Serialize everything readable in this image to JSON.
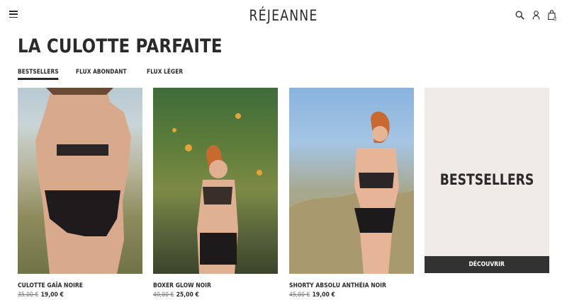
{
  "brand": "RÉJEANNE",
  "header": {
    "menu_icon": "hamburger-icon",
    "icons": [
      "search-icon",
      "account-icon",
      "cart-icon"
    ],
    "cart_count": "0"
  },
  "page_title": "LA CULOTTE PARFAITE",
  "tabs": [
    {
      "label": "BESTSELLERS",
      "active": true
    },
    {
      "label": "FLUX ABONDANT",
      "active": false
    },
    {
      "label": "FLUX LÉGER",
      "active": false
    }
  ],
  "products": [
    {
      "name": "CULOTTE GAÏA NOIRE",
      "old_price": "35,00 €",
      "price": "19,00 €"
    },
    {
      "name": "BOXER GLOW NOIR",
      "old_price": "40,00 €",
      "price": "25,00 €"
    },
    {
      "name": "SHORTY ABSOLU ANTHÉIA NOIR",
      "old_price": "45,00 €",
      "price": "19,00 €"
    }
  ],
  "promo": {
    "title": "BESTSELLERS",
    "button": "DÉCOUVRIR"
  },
  "colors": {
    "text": "#2b2a2a",
    "promo_bg": "#efebe6",
    "button_bg": "#333232"
  }
}
